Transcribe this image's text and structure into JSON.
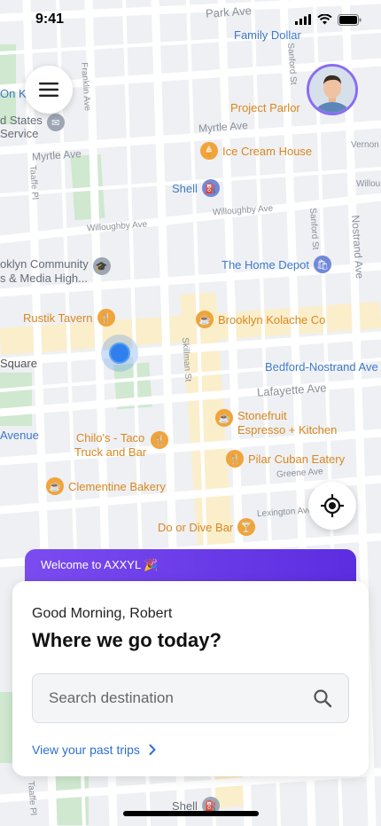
{
  "status": {
    "time": "9:41"
  },
  "map": {
    "streets": {
      "park_ave": "Park Ave",
      "franklin_ave": "Franklin Ave",
      "sanford_st_top": "Sanford St",
      "myrtle_ave_left": "Myrtle Ave",
      "myrtle_ave_mid": "Myrtle Ave",
      "vernon_ave": "Vernon A",
      "taaffe_pl": "Taaffe Pl",
      "willoughby_ave_left": "Willoughby Ave",
      "willoughby_ave_right": "Willoughby Ave",
      "willoughby_ave_edge": "Willou",
      "sanford_st_mid": "Sanford St",
      "nostrand_ave": "Nostrand Ave",
      "skillman_st": "Skillman St",
      "lafayette_ave": "Lafayette Ave",
      "greene_ave": "Greene Ave",
      "lexington_ave": "Lexington Ave",
      "square": "Square",
      "avenue": "Avenue",
      "ok": "On K",
      "bottom_taaffe": "Taaffe Pl"
    },
    "pois": {
      "family_dollar": "Family Dollar",
      "project_parlor": "Project Parlor",
      "ice_cream_house": "Ice Cream House",
      "shell_top": "Shell",
      "the_home_depot": "The Home Depot",
      "brooklyn_community": "oklyn Community\ns & Media High...",
      "states_service": "d States\nService",
      "rustik_tavern": "Rustik Tavern",
      "brooklyn_kolache": "Brooklyn Kolache Co",
      "bedford_nostrand": "Bedford-Nostrand Ave",
      "stonefruit": "Stonefruit\nEspresso + Kitchen",
      "chilos": "Chilo's - Taco\nTruck and Bar",
      "pilar_cuban": "Pilar Cuban Eatery",
      "clementine": "Clementine Bakery",
      "do_or_dive": "Do or Dive Bar",
      "shell_bottom": "Shell"
    }
  },
  "sheet": {
    "welcome": "Welcome to AXXYL 🎉",
    "greeting": "Good Morning, Robert",
    "headline": "Where we go today?",
    "search_placeholder": "Search destination",
    "past_trips": "View your past trips"
  },
  "colors": {
    "accent": "#6a3ce8",
    "link": "#2f6fd1",
    "user_location": "#2f80ed"
  }
}
